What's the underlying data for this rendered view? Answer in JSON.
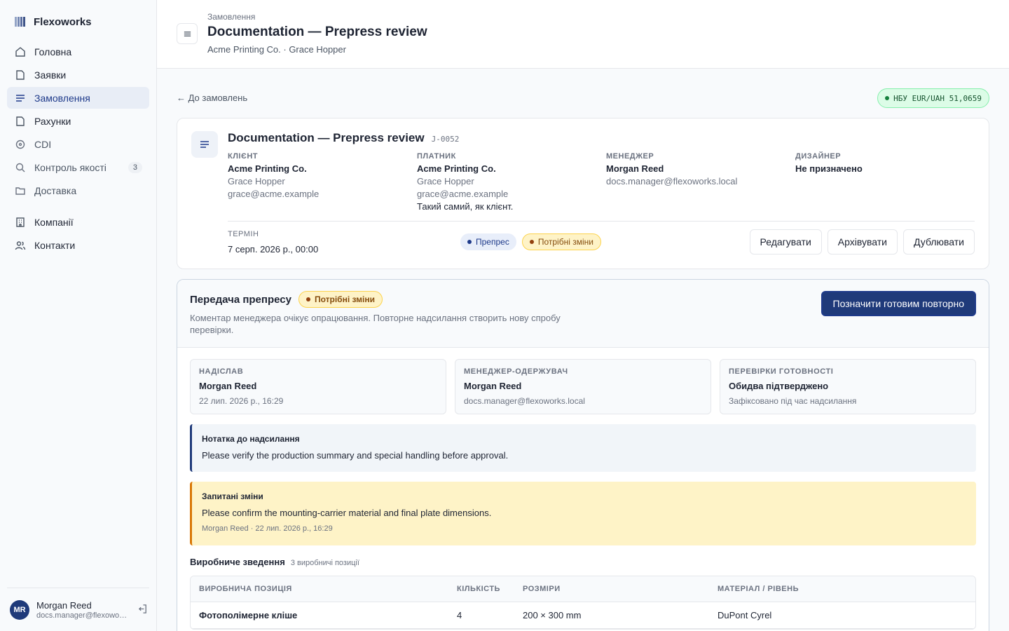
{
  "app": {
    "name": "Flexoworks"
  },
  "sidebar": {
    "items": [
      {
        "label": "Головна"
      },
      {
        "label": "Заявки"
      },
      {
        "label": "Замовлення"
      },
      {
        "label": "Рахунки"
      },
      {
        "label": "CDI"
      },
      {
        "label": "Контроль якості",
        "badge": "3"
      },
      {
        "label": "Доставка"
      },
      {
        "label": "Компанії"
      },
      {
        "label": "Контакти"
      }
    ],
    "active_index": 2
  },
  "user": {
    "initials": "MR",
    "name": "Morgan Reed",
    "email": "docs.manager@flexoworks.local"
  },
  "header": {
    "breadcrumb": "Замовлення",
    "title": "Documentation — Prepress review",
    "subtitle": "Acme Printing Co. · Grace Hopper"
  },
  "toolbar": {
    "back_link": "← До замовлень",
    "rate": "НБУ EUR/UAH 51,0659"
  },
  "order": {
    "title": "Documentation — Prepress review",
    "code": "J-0052",
    "client": {
      "label": "КЛІЄНТ",
      "company": "Acme Printing Co.",
      "contact": "Grace Hopper",
      "email": "grace@acme.example"
    },
    "payer": {
      "label": "ПЛАТНИК",
      "company": "Acme Printing Co.",
      "contact": "Grace Hopper",
      "email": "grace@acme.example",
      "note": "Такий самий, як клієнт."
    },
    "manager": {
      "label": "МЕНЕДЖЕР",
      "name": "Morgan Reed",
      "email": "docs.manager@flexoworks.local"
    },
    "designer": {
      "label": "ДИЗАЙНЕР",
      "name": "Не призначено"
    },
    "term": {
      "label": "ТЕРМІН",
      "value": "7 серп. 2026 р., 00:00"
    },
    "status_stage": "Препрес",
    "status_state": "Потрібні зміни",
    "actions": {
      "edit": "Редагувати",
      "archive": "Архівувати",
      "duplicate": "Дублювати"
    }
  },
  "prepress": {
    "title": "Передача препресу",
    "status": "Потрібні зміни",
    "description": "Коментар менеджера очікує опрацювання. Повторне надсилання створить нову спробу перевірки.",
    "primary_action": "Позначити готовим повторно",
    "sent_by": {
      "label": "НАДІСЛАВ",
      "name": "Morgan Reed",
      "date": "22 лип. 2026 р., 16:29"
    },
    "recipient": {
      "label": "МЕНЕДЖЕР-ОДЕРЖУВАЧ",
      "name": "Morgan Reed",
      "email": "docs.manager@flexoworks.local"
    },
    "checks": {
      "label": "ПЕРЕВІРКИ ГОТОВНОСТІ",
      "value": "Обидва підтверджено",
      "note": "Зафіксовано під час надсилання"
    },
    "submission_note": {
      "title": "Нотатка до надсилання",
      "text": "Please verify the production summary and special handling before approval."
    },
    "requested_changes": {
      "title": "Запитані зміни",
      "text": "Please confirm the mounting-carrier material and final plate dimensions.",
      "meta": "Morgan Reed · 22 лип. 2026 р., 16:29"
    },
    "summary": {
      "title": "Виробниче зведення",
      "count": "3 виробничі позиції",
      "columns": [
        "ВИРОБНИЧА ПОЗИЦІЯ",
        "КІЛЬКІСТЬ",
        "РОЗМІРИ",
        "МАТЕРІАЛ / РІВЕНЬ"
      ],
      "rows": [
        {
          "item": "Фотополімерне кліше",
          "qty": "4",
          "size": "200 × 300 mm",
          "material": "DuPont Cyrel"
        }
      ]
    }
  },
  "colors": {
    "accent": "#1f3a7a",
    "warning_bg": "#fef3c7",
    "success_bg": "#dcfce7"
  }
}
